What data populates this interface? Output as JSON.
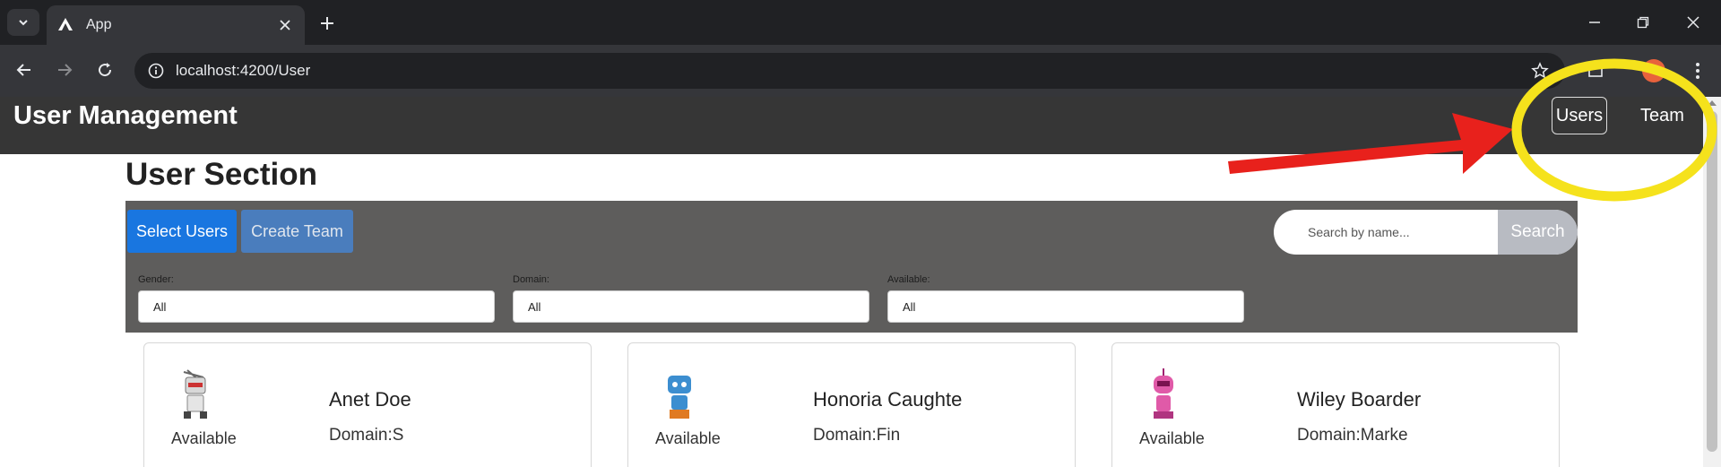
{
  "browser": {
    "tab_title": "App",
    "url": "localhost:4200/User"
  },
  "app": {
    "brand": "User Management",
    "nav": {
      "users": "Users",
      "team": "Team"
    }
  },
  "section": {
    "title": "User Section",
    "buttons": {
      "select_users": "Select Users",
      "create_team": "Create Team"
    },
    "search": {
      "placeholder": "Search by name...",
      "button": "Search"
    },
    "filters": [
      {
        "label": "Gender:",
        "value": "All"
      },
      {
        "label": "Domain:",
        "value": "All"
      },
      {
        "label": "Available:",
        "value": "All"
      }
    ]
  },
  "users": [
    {
      "name": "Anet Doe",
      "domain": "Domain:S",
      "status": "Available"
    },
    {
      "name": "Honoria Caughte",
      "domain": "Domain:Fin",
      "status": "Available"
    },
    {
      "name": "Wiley Boarder",
      "domain": "Domain:Marke",
      "status": "Available"
    }
  ],
  "colors": {
    "annotation_arrow": "#e8211c",
    "annotation_circle": "#f5e21c",
    "primary_button": "#1976e0",
    "navbar": "#363636"
  }
}
